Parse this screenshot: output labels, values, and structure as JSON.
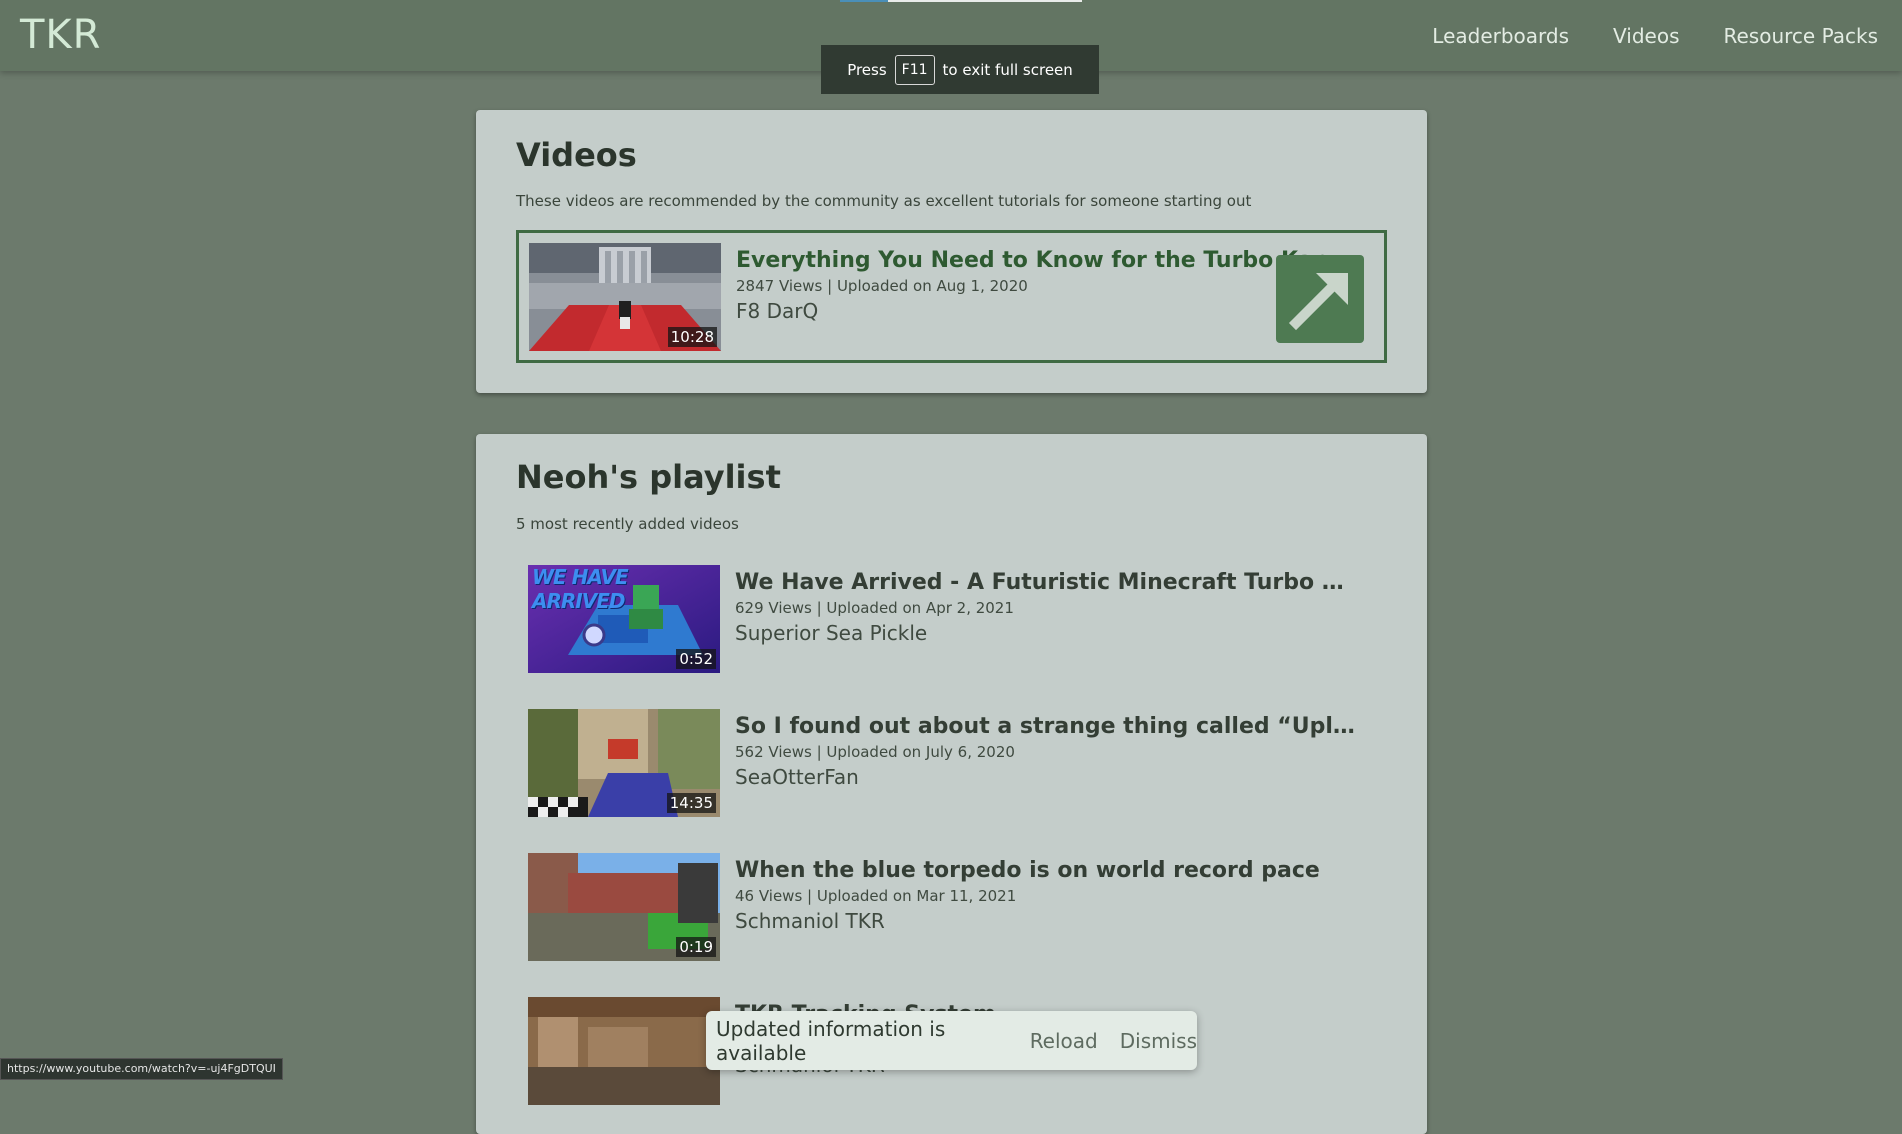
{
  "header": {
    "logo": "TKR",
    "nav": [
      "Leaderboards",
      "Videos",
      "Resource Packs"
    ]
  },
  "fullscreen_notice": {
    "prefix": "Press",
    "key": "F11",
    "suffix": "to exit full screen"
  },
  "videos_section": {
    "title": "Videos",
    "subtitle": "These videos are recommended by the community as excellent tutorials for someone starting out",
    "featured": {
      "title": "Everything You Need to Know for the Turbo Kart Racers ...",
      "meta": "2847 Views | Uploaded on Aug 1, 2020",
      "channel": "F8 DarQ",
      "duration": "10:28",
      "open_icon": "external-link-arrow-icon"
    }
  },
  "playlist_section": {
    "title": "Neoh's playlist",
    "subtitle": "5 most recently added videos",
    "videos": [
      {
        "title": "We Have Arrived - A Futuristic Minecraft Turbo Kart Ra...",
        "meta": "629 Views | Uploaded on Apr 2, 2021",
        "channel": "Superior Sea Pickle",
        "duration": "0:52",
        "thumb_text": "WE HAVE ARRIVED"
      },
      {
        "title": "So I found out about a strange thing called “Uploading...",
        "meta": "562 Views | Uploaded on July 6, 2020",
        "channel": "SeaOtterFan",
        "duration": "14:35"
      },
      {
        "title": "When the blue torpedo is on world record pace",
        "meta": "46 Views | Uploaded on Mar 11, 2021",
        "channel": "Schmaniol TKR",
        "duration": "0:19"
      },
      {
        "title": "TKR Tracking System ...",
        "meta": "",
        "channel": "Schmaniol TKR",
        "duration": ""
      }
    ]
  },
  "status_bar_url": "https://www.youtube.com/watch?v=-uj4FgDTQUI",
  "update_toast": {
    "message": "Updated information is available",
    "reload": "Reload",
    "dismiss": "Dismiss"
  },
  "colors": {
    "background": "#6c7a6c",
    "header": "#637563",
    "card": "#c4cdca",
    "accent_green": "#4e7a52"
  }
}
